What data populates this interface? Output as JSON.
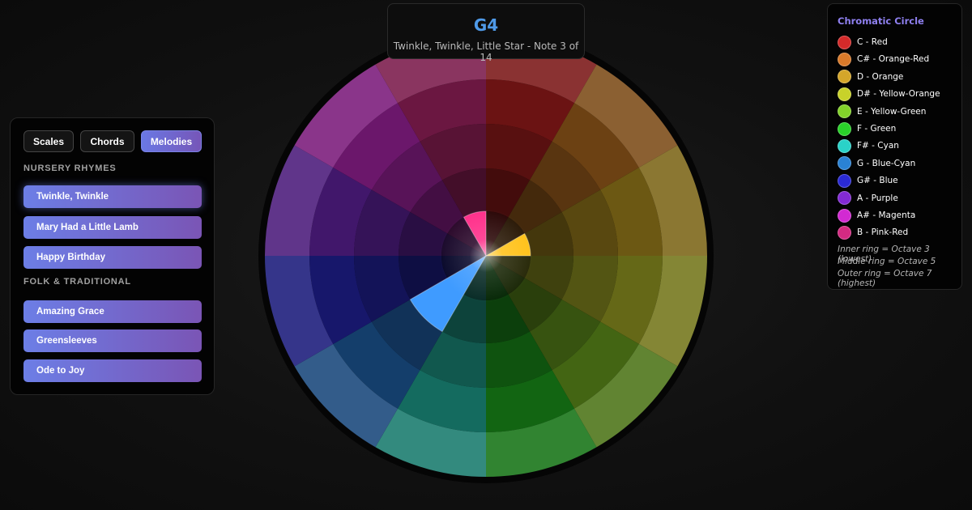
{
  "now_playing": {
    "note": "G4",
    "info": "Twinkle, Twinkle, Little Star - Note 3 of 14"
  },
  "tabs": [
    "Scales",
    "Chords",
    "Melodies"
  ],
  "active_tab": "Melodies",
  "sections": [
    {
      "title": "NURSERY RHYMES",
      "songs": [
        "Twinkle, Twinkle",
        "Mary Had a Little Lamb",
        "Happy Birthday"
      ]
    },
    {
      "title": "FOLK & TRADITIONAL",
      "songs": [
        "Amazing Grace",
        "Greensleeves",
        "Ode to Joy"
      ]
    }
  ],
  "selected_song": "Twinkle, Twinkle",
  "legend": {
    "title": "Chromatic Circle",
    "items": [
      {
        "label": "C - Red",
        "color": "#d42a2a"
      },
      {
        "label": "C# - Orange-Red",
        "color": "#d97a2a"
      },
      {
        "label": "D - Orange",
        "color": "#d4a62a"
      },
      {
        "label": "D# - Yellow-Orange",
        "color": "#c8d22a"
      },
      {
        "label": "E - Yellow-Green",
        "color": "#82d22a"
      },
      {
        "label": "F - Green",
        "color": "#2ad22a"
      },
      {
        "label": "F# - Cyan",
        "color": "#2ad2c8"
      },
      {
        "label": "G - Blue-Cyan",
        "color": "#2a82d4"
      },
      {
        "label": "G# - Blue",
        "color": "#2a2ad4"
      },
      {
        "label": "A - Purple",
        "color": "#822ad4"
      },
      {
        "label": "A# - Magenta",
        "color": "#d22ad2"
      },
      {
        "label": "B - Pink-Red",
        "color": "#d42a82"
      }
    ],
    "notes": [
      "Inner ring = Octave 3 (lowest)",
      "Middle ring = Octave 5",
      "Outer ring = Octave 7 (highest)"
    ]
  },
  "wheel": {
    "ring_count": 5,
    "segment_colors": [
      "#7a1616",
      "#7b4a16",
      "#7b6416",
      "#73761a",
      "#4c7316",
      "#157315",
      "#177a6c",
      "#17467a",
      "#1a1a7a",
      "#4a1a7a",
      "#7a1a7a",
      "#7a1a4a"
    ],
    "highlights": [
      {
        "note": "B",
        "color": "#ff2f8a"
      },
      {
        "note": "D",
        "color": "#ffc21a"
      },
      {
        "note": "G",
        "color": "#3f9bff",
        "reach": 2
      }
    ]
  }
}
